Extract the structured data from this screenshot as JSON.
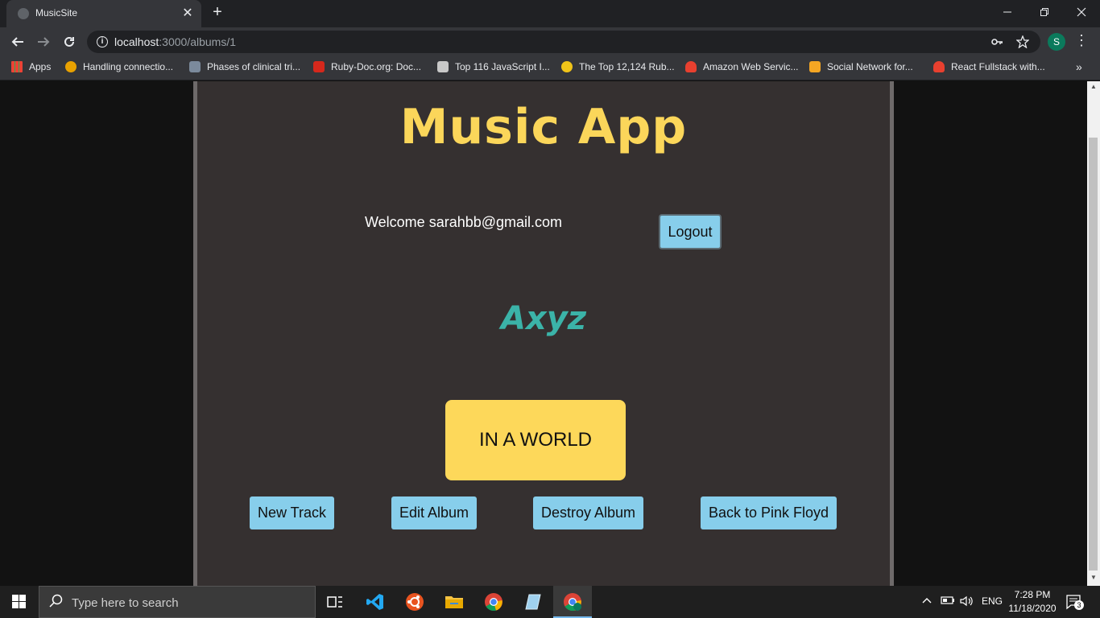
{
  "browser": {
    "tab_title": "MusicSite",
    "tab_close": "✕",
    "new_tab": "+",
    "url_host": "localhost",
    "url_path": ":3000/albums/1",
    "profile_initial": "S",
    "bookmarks": [
      {
        "label": "Apps",
        "color": "#4285f4"
      },
      {
        "label": "Handling connectio...",
        "color": "#e8a100"
      },
      {
        "label": "Phases of clinical tri...",
        "color": "#7b8a9c"
      },
      {
        "label": "Ruby-Doc.org: Doc...",
        "color": "#d6281c"
      },
      {
        "label": "Top 116 JavaScript I...",
        "color": "#c8c8c8"
      },
      {
        "label": "The Top 12,124 Rub...",
        "color": "#f0c419"
      },
      {
        "label": "Amazon Web Servic...",
        "color": "#e8402f"
      },
      {
        "label": "Social Network for...",
        "color": "#f5a623"
      },
      {
        "label": "React Fullstack with...",
        "color": "#e8402f"
      }
    ],
    "more_bookmarks": "»"
  },
  "app": {
    "title": "Music App",
    "welcome": "Welcome sarahbb@gmail.com",
    "logout": "Logout",
    "album_name": "Axyz",
    "track": "IN A WORLD",
    "actions": {
      "new_track": "New Track",
      "edit_album": "Edit Album",
      "destroy_album": "Destroy Album",
      "back": "Back to Pink Floyd"
    }
  },
  "taskbar": {
    "search_placeholder": "Type here to search",
    "language": "ENG",
    "time": "7:28 PM",
    "date": "11/18/2020",
    "notifications": "3"
  },
  "colors": {
    "title_yellow": "#fbd65a",
    "album_teal": "#3bb3a8",
    "button_blue": "#87ceeb",
    "panel_bg": "#353030"
  }
}
